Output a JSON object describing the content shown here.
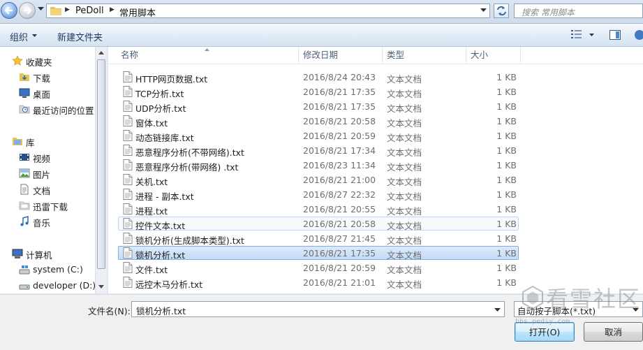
{
  "address_bar": {
    "breadcrumbs": [
      "PeDoll",
      "常用脚本"
    ],
    "search_placeholder": "搜索 常用脚本"
  },
  "toolbar": {
    "organize_label": "组织",
    "new_folder_label": "新建文件夹"
  },
  "nav_pane": {
    "items": [
      {
        "label": "收藏夹",
        "icon": "star-icon"
      },
      {
        "label": "下载",
        "icon": "download-folder-icon"
      },
      {
        "label": "桌面",
        "icon": "desktop-icon"
      },
      {
        "label": "最近访问的位置",
        "icon": "recent-places-icon"
      },
      {
        "label": "库",
        "icon": "library-icon"
      },
      {
        "label": "视频",
        "icon": "video-library-icon"
      },
      {
        "label": "图片",
        "icon": "pictures-library-icon"
      },
      {
        "label": "文档",
        "icon": "documents-library-icon"
      },
      {
        "label": "迅雷下载",
        "icon": "thunder-download-icon"
      },
      {
        "label": "音乐",
        "icon": "music-library-icon"
      },
      {
        "label": "计算机",
        "icon": "computer-icon"
      },
      {
        "label": "system (C:)",
        "icon": "system-drive-icon"
      },
      {
        "label": "developer (D:)",
        "icon": "drive-icon"
      }
    ]
  },
  "file_list": {
    "columns": {
      "name": "名称",
      "date": "修改日期",
      "type": "类型",
      "size": "大小"
    },
    "rows": [
      {
        "name": "HTTP网页数据.txt",
        "date": "2016/8/24 20:43",
        "type": "文本文档",
        "size": "1 KB"
      },
      {
        "name": "TCP分析.txt",
        "date": "2016/8/21 17:35",
        "type": "文本文档",
        "size": "1 KB"
      },
      {
        "name": "UDP分析.txt",
        "date": "2016/8/21 17:35",
        "type": "文本文档",
        "size": "1 KB"
      },
      {
        "name": "窗体.txt",
        "date": "2016/8/21 20:58",
        "type": "文本文档",
        "size": "1 KB"
      },
      {
        "name": "动态链接库.txt",
        "date": "2016/8/21 20:59",
        "type": "文本文档",
        "size": "1 KB"
      },
      {
        "name": "恶意程序分析(不带网络).txt",
        "date": "2016/8/21 17:34",
        "type": "文本文档",
        "size": "1 KB"
      },
      {
        "name": "恶意程序分析(带网络) .txt",
        "date": "2016/8/23 11:34",
        "type": "文本文档",
        "size": "1 KB"
      },
      {
        "name": "关机.txt",
        "date": "2016/8/21 21:00",
        "type": "文本文档",
        "size": "1 KB"
      },
      {
        "name": "进程 - 副本.txt",
        "date": "2016/8/27 22:32",
        "type": "文本文档",
        "size": "1 KB"
      },
      {
        "name": "进程.txt",
        "date": "2016/8/21 20:55",
        "type": "文本文档",
        "size": "1 KB"
      },
      {
        "name": "控件文本.txt",
        "date": "2016/8/21 20:58",
        "type": "文本文档",
        "size": "1 KB"
      },
      {
        "name": "锁机分析(生成脚本类型).txt",
        "date": "2016/8/27 21:45",
        "type": "文本文档",
        "size": "1 KB"
      },
      {
        "name": "锁机分析.txt",
        "date": "2016/8/21 17:35",
        "type": "文本文档",
        "size": "1 KB"
      },
      {
        "name": "文件.txt",
        "date": "2016/8/21 20:59",
        "type": "文本文档",
        "size": "1 KB"
      },
      {
        "name": "远控木马分析.txt",
        "date": "2016/8/21 21:01",
        "type": "文本文档",
        "size": "1 KB"
      }
    ]
  },
  "bottom": {
    "filename_label": "文件名(N):",
    "filename_value": "锁机分析.txt",
    "filetype_value": "自动按子脚本(*.txt)",
    "open_label": "打开(O)",
    "cancel_label": "取消"
  },
  "watermark": {
    "main": "看雪社区",
    "sub": "bbs.pediy.com"
  },
  "colors": {
    "selected_row": "#c4dcf7",
    "hover_row": "#f7fbff",
    "accent": "#3c7fb1"
  }
}
